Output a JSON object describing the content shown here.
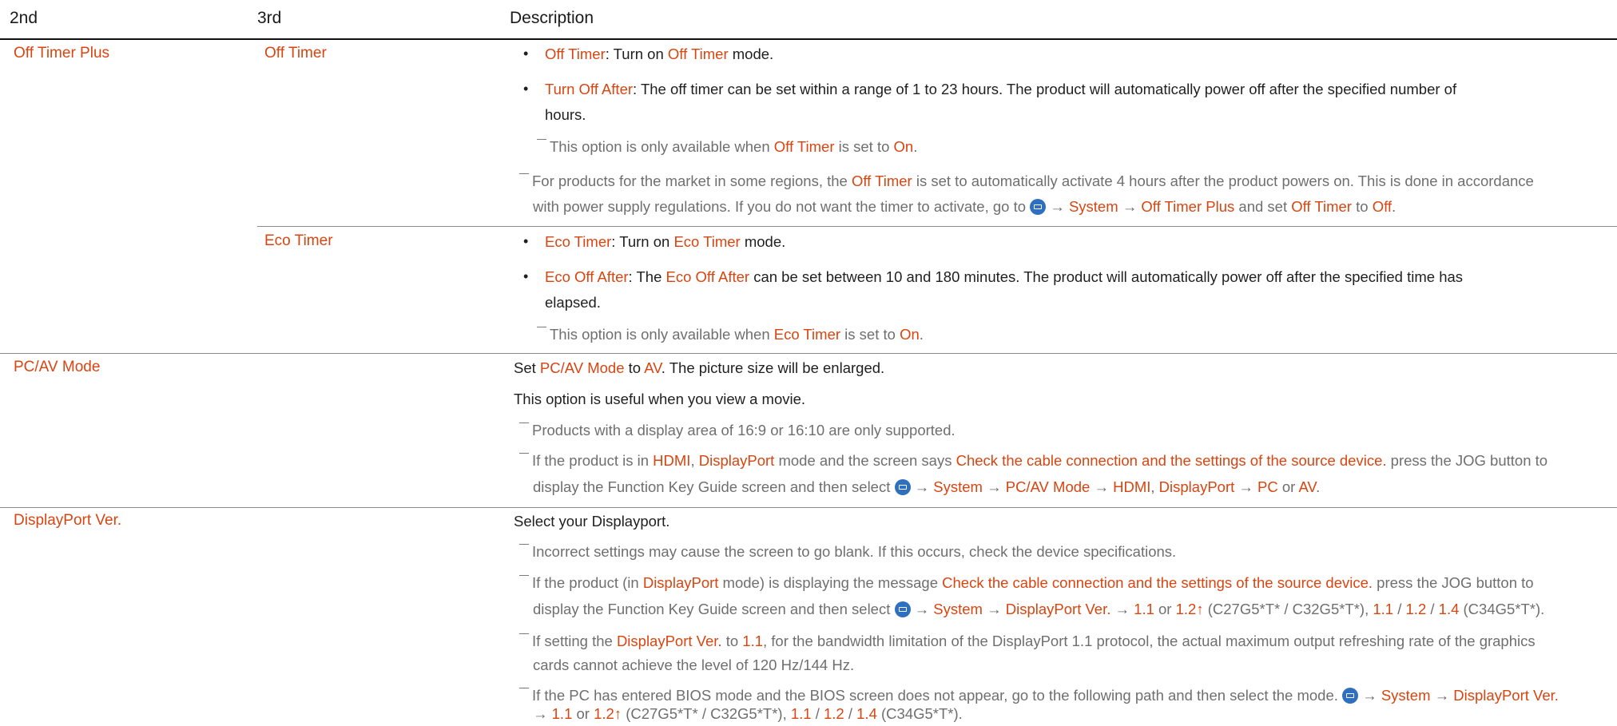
{
  "header": {
    "col2": "2nd",
    "col3": "3rd",
    "col4": "Description"
  },
  "off_timer_plus": {
    "label_2nd": "Off Timer Plus",
    "label_3rd": "Off Timer",
    "b1": {
      "t1": "Off Timer",
      "t2": ": Turn on ",
      "t3": "Off Timer",
      "t4": " mode."
    },
    "b2": {
      "t1": "Turn Off After",
      "t2": ": The off timer can be set within a range of 1 to 23 hours. The product will automatically power off after the specified number of",
      "t3": "hours."
    },
    "n1": {
      "t1": "This option is only available when ",
      "t2": "Off Timer",
      "t3": " is set to ",
      "t4": "On",
      "t5": "."
    },
    "n2": {
      "t1": "For products for the market in some regions, the ",
      "t2": "Off Timer",
      "t3": " is set to automatically activate 4 hours after the product powers on. This is done in accordance",
      "t4": "with power supply regulations. If you do not want the timer to activate, go to ",
      "t5": " → ",
      "t6": "System",
      "t7": " → ",
      "t8": "Off Timer Plus",
      "t9": " and set ",
      "t10": "Off Timer",
      "t11": " to ",
      "t12": "Off",
      "t13": "."
    }
  },
  "eco_timer": {
    "label_3rd": "Eco Timer",
    "b1": {
      "t1": "Eco Timer",
      "t2": ": Turn on ",
      "t3": "Eco Timer",
      "t4": " mode."
    },
    "b2": {
      "t1": "Eco Off After",
      "t2": ": The ",
      "t3": "Eco Off After",
      "t4": " can be set between 10 and 180 minutes. The product will automatically power off after the specified time has",
      "t5": "elapsed."
    },
    "n1": {
      "t1": "This option is only available when ",
      "t2": "Eco Timer",
      "t3": " is set to ",
      "t4": "On",
      "t5": "."
    }
  },
  "pcav": {
    "label_2nd": "PC/AV Mode",
    "l1": {
      "t1": "Set ",
      "t2": "PC/AV Mode",
      "t3": " to ",
      "t4": "AV",
      "t5": ". The picture size will be enlarged."
    },
    "l2": "This option is useful when you view a movie.",
    "n1": "Products with a display area of 16:9 or 16:10 are only supported.",
    "n2": {
      "t1": "If the product is in ",
      "t2": "HDMI",
      "t3": ", ",
      "t4": "DisplayPort",
      "t5": " mode and the screen says ",
      "t6": "Check the cable connection and the settings of the source device.",
      "t7": " press the JOG button to",
      "t8": "display the Function Key Guide screen and then select ",
      "t9": " → ",
      "t10": "System",
      "t11": " → ",
      "t12": "PC/AV Mode",
      "t13": " → ",
      "t14": "HDMI",
      "t15": ", ",
      "t16": "DisplayPort",
      "t17": " → ",
      "t18": "PC",
      "t19": " or ",
      "t20": "AV",
      "t21": "."
    }
  },
  "dpver": {
    "label_2nd": "DisplayPort Ver.",
    "l1": "Select your Displayport.",
    "n1": "Incorrect settings may cause the screen to go blank. If this occurs, check the device specifications.",
    "n2": {
      "t1": "If the product (in ",
      "t2": "DisplayPort",
      "t3": " mode) is displaying the message ",
      "t4": "Check the cable connection and the settings of the source device.",
      "t5": " press the JOG button to",
      "t6": "display the Function Key Guide screen and then select ",
      "t7": " → ",
      "t8": "System",
      "t9": " → ",
      "t10": "DisplayPort Ver.",
      "t11": " → ",
      "t12": "1.1",
      "t13": " or ",
      "t14": "1.2↑",
      "t15": " (C27G5*T* / C32G5*T*), ",
      "t16": "1.1",
      "t17": " / ",
      "t18": "1.2",
      "t19": " / ",
      "t20": "1.4",
      "t21": " (C34G5*T*)."
    },
    "n3": {
      "t1": "If setting the ",
      "t2": "DisplayPort Ver.",
      "t3": " to ",
      "t4": "1.1",
      "t5": ", for the bandwidth limitation of the DisplayPort 1.1 protocol, the actual maximum output refreshing rate of the graphics",
      "t6": "cards cannot achieve the level of 120 Hz/144 Hz."
    },
    "n4": {
      "t1": "If the PC has entered BIOS mode and the BIOS screen does not appear, go to the following path and then select the mode. ",
      "t2": " → ",
      "t3": "System",
      "t4": " → ",
      "t5": "DisplayPort Ver.",
      "t6": "→ ",
      "t7": "1.1",
      "t8": " or ",
      "t9": "1.2↑",
      "t10": " (C27G5*T* / C32G5*T*), ",
      "t11": "1.1",
      "t12": " / ",
      "t13": "1.2",
      "t14": " / ",
      "t15": "1.4",
      "t16": " (C34G5*T*)."
    }
  }
}
